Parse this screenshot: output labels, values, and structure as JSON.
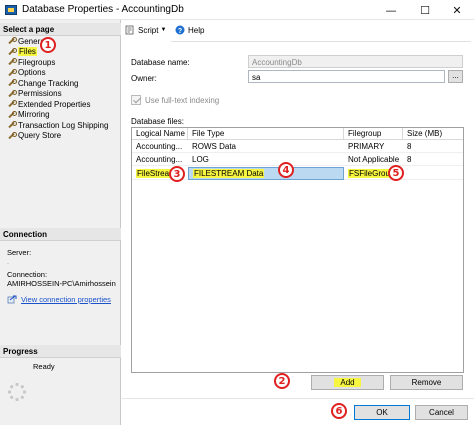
{
  "window": {
    "title": "Database Properties - AccountingDb"
  },
  "left_pane": {
    "select_page_header": "Select a page",
    "pages": [
      {
        "label": "General"
      },
      {
        "label": "Files"
      },
      {
        "label": "Filegroups"
      },
      {
        "label": "Options"
      },
      {
        "label": "Change Tracking"
      },
      {
        "label": "Permissions"
      },
      {
        "label": "Extended Properties"
      },
      {
        "label": "Mirroring"
      },
      {
        "label": "Transaction Log Shipping"
      },
      {
        "label": "Query Store"
      }
    ],
    "connection_header": "Connection",
    "server_label": "Server:",
    "server_value": ".",
    "connection_label": "Connection:",
    "connection_value": "AMIRHOSSEIN-PC\\Amirhossein",
    "view_connection_link": "View connection properties",
    "progress_header": "Progress",
    "progress_status": "Ready"
  },
  "toolbar": {
    "script_label": "Script",
    "help_label": "Help"
  },
  "form": {
    "database_name_label": "Database name:",
    "database_name_value": "AccountingDb",
    "owner_label": "Owner:",
    "owner_value": "sa",
    "browse_label": "...",
    "fulltext_label": "Use full-text indexing",
    "fulltext_checked": true,
    "database_files_label": "Database files:"
  },
  "grid": {
    "columns": [
      "Logical Name",
      "File Type",
      "Filegroup",
      "Size (MB)"
    ],
    "rows": [
      {
        "logical_name": "Accounting...",
        "file_type": "ROWS Data",
        "filegroup": "PRIMARY",
        "size": "8"
      },
      {
        "logical_name": "Accounting...",
        "file_type": "LOG",
        "filegroup": "Not Applicable",
        "size": "8"
      },
      {
        "logical_name": "FileStream",
        "file_type": "FILESTREAM Data",
        "filegroup": "FSFileGroup",
        "size": ""
      }
    ]
  },
  "buttons": {
    "add": "Add",
    "remove": "Remove",
    "ok": "OK",
    "cancel": "Cancel"
  },
  "markers": [
    "1",
    "2",
    "3",
    "4",
    "5",
    "6"
  ],
  "colors": {
    "highlight": "#f5f542",
    "marker": "#e02020",
    "link": "#1a52c9",
    "selection": "#bcd9f2"
  }
}
